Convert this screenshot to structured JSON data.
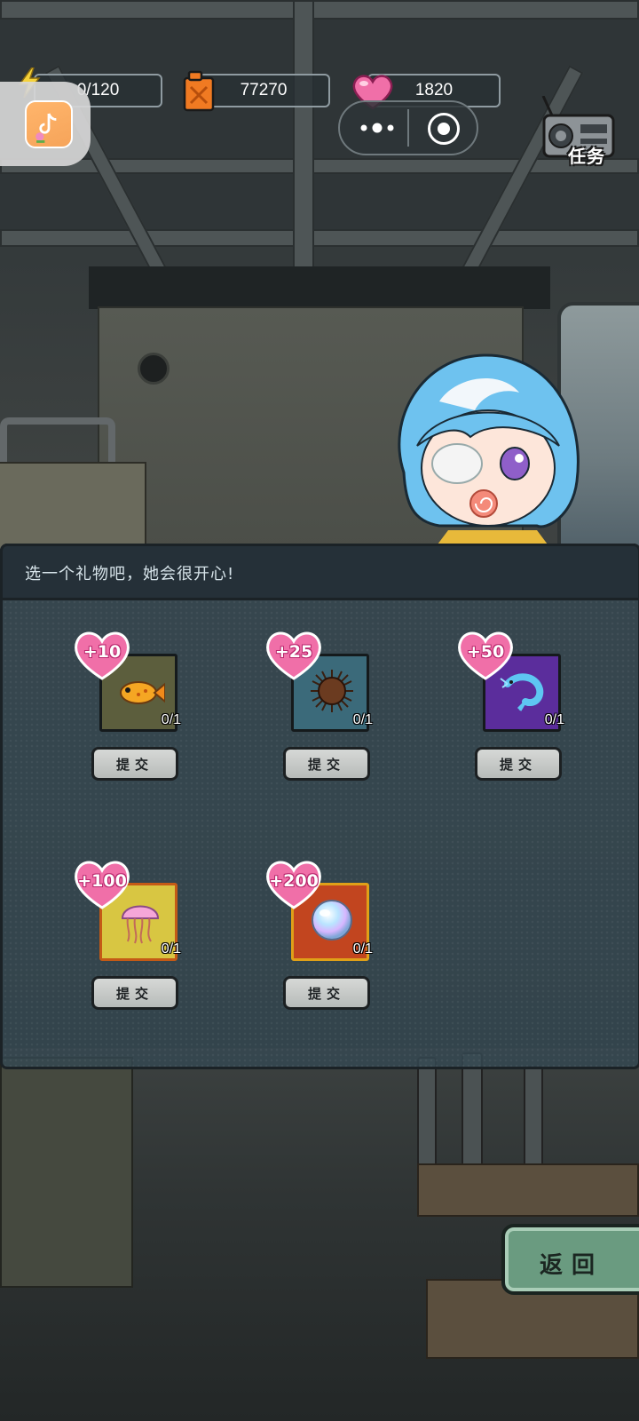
{
  "hud": {
    "energy": "0/120",
    "fuel": "77270",
    "hearts": "1820"
  },
  "top_icons": {
    "mini_app": "tiktok-mini-app-icon",
    "menu": "more-dots-icon",
    "close": "record-target-icon",
    "task_label": "任务"
  },
  "gift_panel": {
    "title": "选一个礼物吧，她会很开心!",
    "gifts": [
      {
        "bonus": "+10",
        "count": "0/1",
        "item": "fish-icon",
        "bg": "#5c5e3d",
        "submit": "提交"
      },
      {
        "bonus": "+25",
        "count": "0/1",
        "item": "sea-urchin-icon",
        "bg": "#3b6a7a",
        "submit": "提交"
      },
      {
        "bonus": "+50",
        "count": "0/1",
        "item": "shrimp-icon",
        "bg": "#5b2d9c",
        "submit": "提交"
      },
      {
        "bonus": "+100",
        "count": "0/1",
        "item": "jellyfish-icon",
        "bg": "#d8c642",
        "submit": "提交"
      },
      {
        "bonus": "+200",
        "count": "0/1",
        "item": "pearl-icon",
        "bg": "#c2451f",
        "submit": "提交"
      }
    ]
  },
  "back_button": {
    "label": "返回"
  },
  "colors": {
    "heart_pink": "#f06fa8",
    "fuel_orange": "#f07a22",
    "energy_yellow": "#f5d23a",
    "back_green": "#6a9b80"
  }
}
